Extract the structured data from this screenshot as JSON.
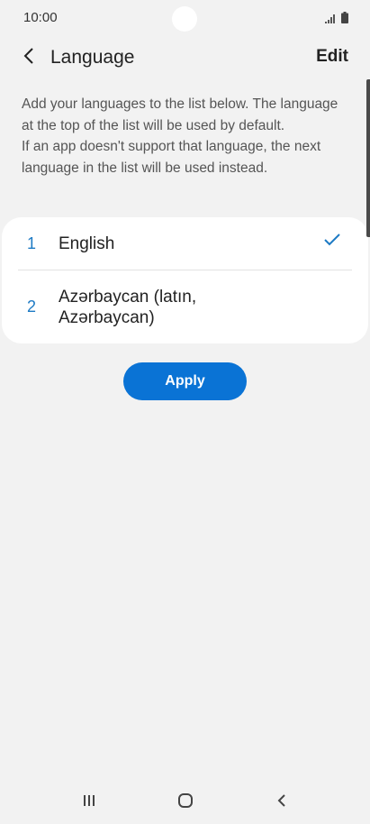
{
  "status_bar": {
    "time": "10:00",
    "icons": [
      "signal-icon",
      "battery-icon"
    ]
  },
  "app_bar": {
    "back_icon": "chevron-left-icon",
    "title": "Language",
    "edit_label": "Edit"
  },
  "description": {
    "paragraph_1": "Add your languages to the list below. The language at the top of the list will be used by default.",
    "paragraph_2": "If an app doesn't support that language, the next language in the list will be used instead."
  },
  "languages": [
    {
      "index": "1",
      "name": "English",
      "selected": true
    },
    {
      "index": "2",
      "name": "Azərbaycan (latın, Azərbaycan)",
      "selected": false
    }
  ],
  "apply_label": "Apply",
  "nav_bar": {
    "icons": [
      "recent-apps-icon",
      "home-icon",
      "back-icon"
    ]
  },
  "colors": {
    "accent": "#0a73d5",
    "index_blue": "#1d7ac4",
    "background": "#f2f2f2",
    "card": "#ffffff"
  }
}
